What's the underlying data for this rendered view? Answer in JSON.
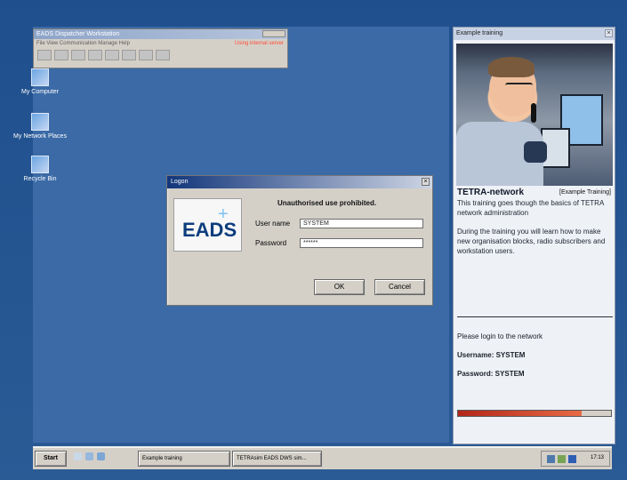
{
  "desktop": {
    "icons": [
      {
        "label": "My Computer"
      },
      {
        "label": "My Network Places"
      },
      {
        "label": "Recycle Bin"
      }
    ]
  },
  "small_window": {
    "title": "EADS Dispatcher Workstation",
    "menu": [
      "File",
      "View",
      "Communication",
      "Manage",
      "Help"
    ],
    "status": "Using internal server"
  },
  "logon": {
    "title": "Logon",
    "logo": "EADS",
    "warning": "Unauthorised use prohibited.",
    "username_label": "User name",
    "username_value": "SYSTEM",
    "password_label": "Password",
    "password_value": "******",
    "ok_label": "OK",
    "cancel_label": "Cancel"
  },
  "training": {
    "title": "Example training",
    "heading": "TETRA-network",
    "tag": "[Example Training]",
    "body": "This training goes though the basics of TETRA network administration\n\nDuring the training you will learn how to make new organisation blocks, radio subscribers and workstation users.",
    "login_intro": "Please login to the network",
    "username_line": "Username: SYSTEM",
    "password_line": "Password: SYSTEM",
    "progress": 0.81
  },
  "taskbar": {
    "start_label": "Start",
    "task1": "Example training",
    "task2": "TETRAsim EADS DWS sim...",
    "clock": "17:13"
  }
}
